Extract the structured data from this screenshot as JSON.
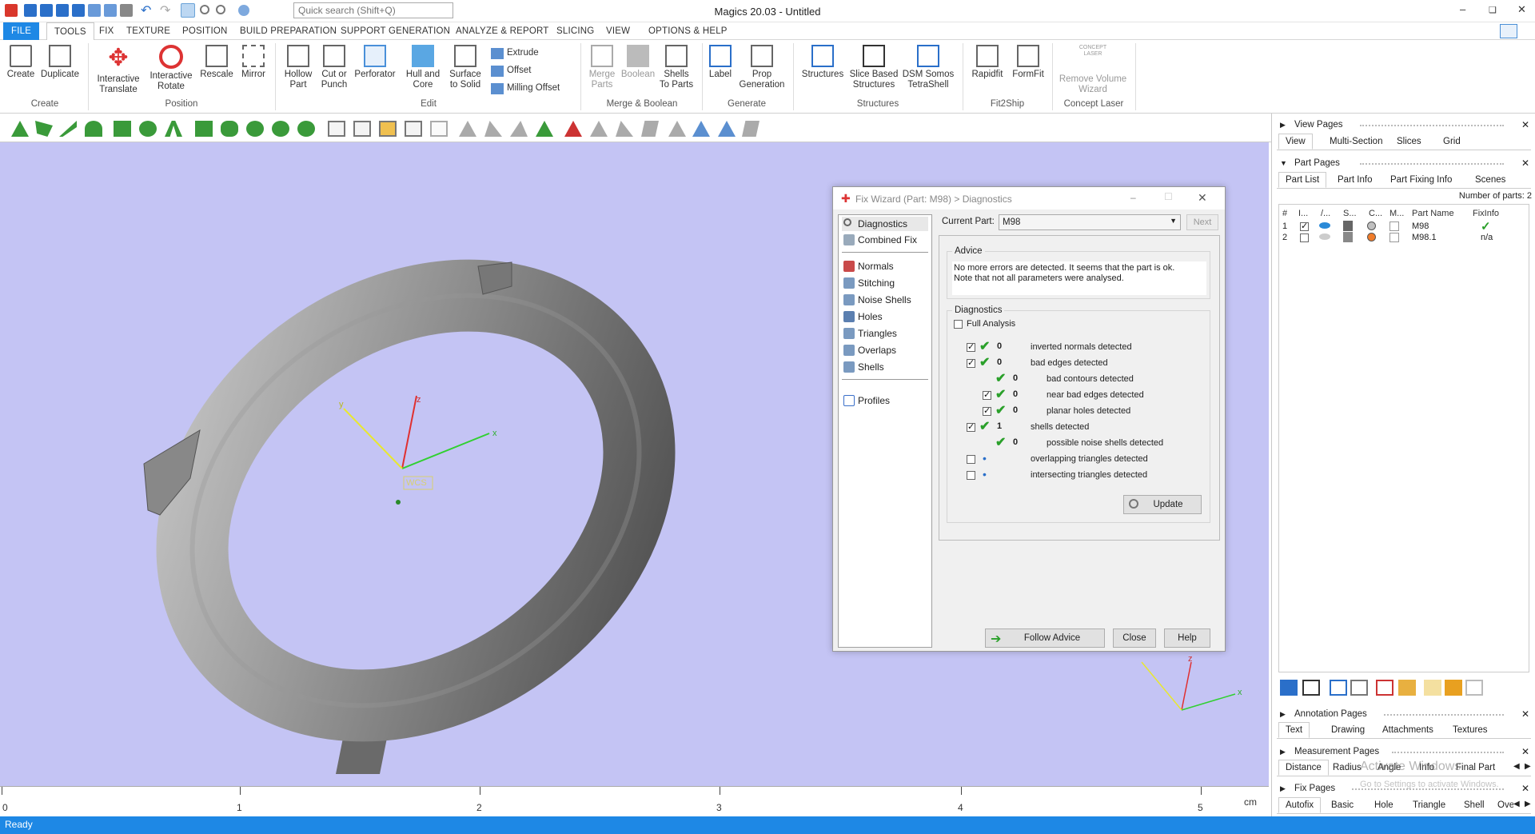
{
  "app": {
    "title": "Magics 20.03 - Untitled",
    "search_placeholder": "Quick search (Shift+Q)"
  },
  "menu": [
    "FILE",
    "TOOLS",
    "FIX",
    "TEXTURE",
    "POSITION",
    "BUILD PREPARATION",
    "SUPPORT GENERATION",
    "ANALYZE & REPORT",
    "SLICING",
    "VIEW",
    "OPTIONS & HELP"
  ],
  "ribbon": {
    "create": "Create",
    "duplicate": "Duplicate",
    "grp_create": "Create",
    "interactive_translate": "Interactive\nTranslate",
    "interactive_rotate": "Interactive\nRotate",
    "rescale": "Rescale",
    "mirror": "Mirror",
    "grp_position": "Position",
    "hollow_part": "Hollow\nPart",
    "cut_or_punch": "Cut or\nPunch",
    "perforator": "Perforator",
    "hull_and_core": "Hull and\nCore",
    "surface_to_solid": "Surface\nto Solid",
    "extrude": "Extrude",
    "offset": "Offset",
    "milling_offset": "Milling Offset",
    "grp_edit": "Edit",
    "merge_parts": "Merge\nParts",
    "boolean": "Boolean",
    "shells_to_parts": "Shells\nTo Parts",
    "grp_merge": "Merge & Boolean",
    "label": "Label",
    "prop_generation": "Prop\nGeneration",
    "grp_generate": "Generate",
    "structures": "Structures",
    "slice_based_structures": "Slice Based\nStructures",
    "dsm_somos": "DSM Somos\nTetraShell",
    "grp_structures": "Structures",
    "rapidfit": "Rapidfit",
    "formfit": "FormFit",
    "grp_fit2ship": "Fit2Ship",
    "concept_laser_logo": "CONCEPT\nLASER",
    "remove_volume_wizard": "Remove Volume\nWizard",
    "grp_concept": "Concept Laser"
  },
  "viewport": {
    "wcs": "WCS",
    "axis_x": "x",
    "axis_y": "y",
    "axis_z": "z",
    "ruler_labels": [
      "0",
      "1",
      "2",
      "3",
      "4",
      "5"
    ],
    "ruler_unit": "cm"
  },
  "status": "Ready",
  "dialog": {
    "title": "Fix Wizard (Part: M98) > Diagnostics",
    "nav": [
      "Diagnostics",
      "Combined Fix",
      "Normals",
      "Stitching",
      "Noise Shells",
      "Holes",
      "Triangles",
      "Overlaps",
      "Shells",
      "Profiles"
    ],
    "current_part_label": "Current Part:",
    "current_part": "M98",
    "next": "Next",
    "advice_label": "Advice",
    "advice_text": "No more errors are detected. It seems that the part is ok.\nNote that not all parameters were analysed.",
    "diagnostics_label": "Diagnostics",
    "full_analysis": "Full Analysis",
    "rows": [
      {
        "count": "0",
        "text": "inverted normals detected"
      },
      {
        "count": "0",
        "text": "bad edges detected"
      },
      {
        "count": "0",
        "text": "bad contours detected"
      },
      {
        "count": "0",
        "text": "near bad edges detected"
      },
      {
        "count": "0",
        "text": "planar holes detected"
      },
      {
        "count": "1",
        "text": "shells detected"
      },
      {
        "count": "0",
        "text": "possible noise shells detected"
      },
      {
        "count": "",
        "text": "overlapping triangles detected"
      },
      {
        "count": "",
        "text": "intersecting triangles detected"
      }
    ],
    "update": "Update",
    "follow_advice": "Follow Advice",
    "close": "Close",
    "help": "Help"
  },
  "right_panel": {
    "view_pages": "View Pages",
    "view_tabs": [
      "View",
      "Multi-Section",
      "Slices",
      "Grid"
    ],
    "part_pages": "Part Pages",
    "part_tabs": [
      "Part List",
      "Part Info",
      "Part Fixing Info",
      "Scenes"
    ],
    "num_parts": "Number of parts: 2",
    "columns": [
      "#",
      "I...",
      "/...",
      "S...",
      "C...",
      "M...",
      "Part Name",
      "FixInfo"
    ],
    "parts": [
      {
        "num": "1",
        "name": "M98",
        "fix": "✓"
      },
      {
        "num": "2",
        "name": "M98.1",
        "fix": "n/a"
      }
    ],
    "annotation_pages": "Annotation Pages",
    "annotation_tabs": [
      "Text",
      "Drawing",
      "Attachments",
      "Textures"
    ],
    "measurement_pages": "Measurement Pages",
    "measurement_tabs": [
      "Distance",
      "Radius",
      "Angle",
      "Info",
      "Final Part"
    ],
    "fix_pages": "Fix Pages",
    "fix_tabs": [
      "Autofix",
      "Basic",
      "Hole",
      "Triangle",
      "Shell",
      "Over"
    ],
    "watermark1": "Activate Windows",
    "watermark2": "Go to Settings to activate Windows."
  },
  "colors": {
    "accent": "#1e88e5",
    "viewport_bg": "#c4c4f4",
    "check_green": "#2aa02a"
  }
}
